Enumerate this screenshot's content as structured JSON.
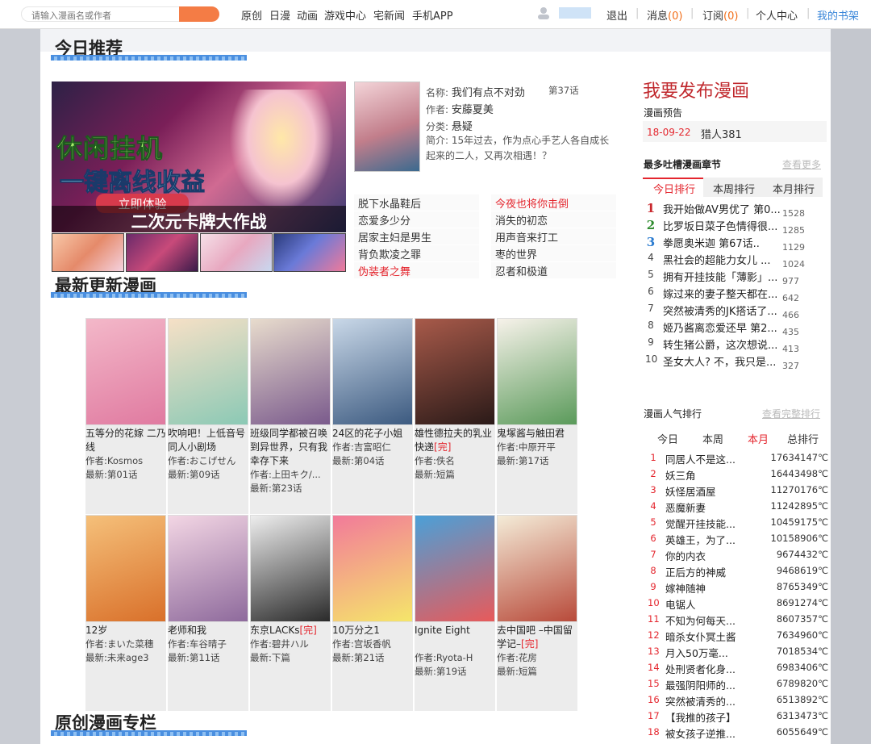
{
  "topbar": {
    "search_placeholder": "请输入漫画名或作者",
    "nav": [
      "原创",
      "日漫",
      "动画",
      "游戏中心",
      "宅新闻",
      "手机APP"
    ],
    "exit": "退出",
    "messages_label": "消息",
    "messages_count": "(0)",
    "subscribe_label": "订阅",
    "subscribe_count": "(0)",
    "personal": "个人中心",
    "mybook": "我的书架"
  },
  "today": {
    "title": "今日推荐",
    "banner": {
      "line1": "休闲挂机",
      "line2": "一键离线收益",
      "button": "立即体验",
      "caption": "二次元卡牌大作战"
    },
    "featured": {
      "name_label": "名称:",
      "name": "我们有点不对劲",
      "chapter": "第37话",
      "author_label": "作者:",
      "author": "安藤夏美",
      "category_label": "分类:",
      "category": "悬疑",
      "intro_label": "简介:",
      "intro": "15年过去，作为点心手艺人各自成长起来的二人，又再次相遇！？"
    },
    "links": [
      {
        "text": "脱下水晶鞋后",
        "red": false
      },
      {
        "text": "今夜也将你击倒",
        "red": true
      },
      {
        "text": "恋爱多少分",
        "red": false
      },
      {
        "text": "消失的初恋",
        "red": false
      },
      {
        "text": "居家主妇是男生",
        "red": false
      },
      {
        "text": "用声音来打工",
        "red": false
      },
      {
        "text": "背负欺凌之罪",
        "red": false
      },
      {
        "text": "枣的世界",
        "red": false
      },
      {
        "text": "伪装者之舞",
        "red": true
      },
      {
        "text": "忍者和极道",
        "red": false
      }
    ]
  },
  "latest": {
    "title": "最新更新漫画",
    "row1": [
      {
        "title": "五等分的花嫁 二乃线",
        "author": "作者:Kosmos",
        "latest": "最新:第01话",
        "color1": "#f3b8c9",
        "color2": "#e07aa0"
      },
      {
        "title": "吹响吧！上低音号 同人小剧场",
        "author": "作者:おこげせん",
        "latest": "最新:第09话",
        "color1": "#f6e0c6",
        "color2": "#8bc9b5"
      },
      {
        "title": "班级同学都被召唤到异世界，只有我幸存下来",
        "author": "作者:上田キク/...",
        "latest": "最新:第23话",
        "color1": "#e8dccd",
        "color2": "#7a5a8c"
      },
      {
        "title": "24区的花子小姐",
        "author": "作者:吉富昭仁",
        "latest": "最新:第04话",
        "color1": "#c9d8e8",
        "color2": "#3c5a80"
      },
      {
        "title": "雄性德拉夫的乳业快递",
        "author": "作者:佚名",
        "latest": "最新:短篇",
        "done": "[完]",
        "color1": "#a85a4a",
        "color2": "#2a1a18"
      },
      {
        "title": "鬼塚酱与触田君",
        "author": "作者:中原开平",
        "latest": "最新:第17话",
        "color1": "#f7f2ea",
        "color2": "#5a9a5a"
      }
    ],
    "row2": [
      {
        "title": "12岁",
        "author": "作者:まいた菜穗",
        "latest": "最新:未来age3",
        "color1": "#f5c07a",
        "color2": "#d9702a"
      },
      {
        "title": "老师和我",
        "author": "作者:车谷晴子",
        "latest": "最新:第11话",
        "color1": "#f3d6e4",
        "color2": "#8e6a9c"
      },
      {
        "title": "东京LACKs",
        "author": "作者:碧井ハル",
        "latest": "最新:下篇",
        "done": "[完]",
        "color1": "#eeeeee",
        "color2": "#2a2a2a"
      },
      {
        "title": "10万分之1",
        "author": "作者:宫坂香帆",
        "latest": "最新:第21话",
        "color1": "#f27a9a",
        "color2": "#f5e66a"
      },
      {
        "title": "Ignite Eight",
        "author": "作者:Ryota-H",
        "latest": "最新:第19话",
        "color1": "#4aa0d8",
        "color2": "#e85a5a"
      },
      {
        "title": "去中国吧 –中国留学记–",
        "author": "作者:花房",
        "latest": "最新:短篇",
        "done": "[完]",
        "color1": "#f4ecd8",
        "color2": "#b84a3a"
      }
    ]
  },
  "original": {
    "title": "原创漫画专栏"
  },
  "right": {
    "publish": "我要发布漫画",
    "preview_label": "漫画预告",
    "preview_date": "18-09-22",
    "preview_name": "猎人381",
    "chapter_title": "最多吐槽漫画章节",
    "chapter_more": "查看更多",
    "chapter_tabs": [
      "今日排行",
      "本周排行",
      "本月排行"
    ],
    "chapters": [
      {
        "n": "1",
        "t": "我开始做AV男优了 第0...",
        "c": "1528"
      },
      {
        "n": "2",
        "t": "比罗坂日菜子色情得很...",
        "c": "1285"
      },
      {
        "n": "3",
        "t": "拳愿奥米迦 第67话..",
        "c": "1129"
      },
      {
        "n": "4",
        "t": "黑社会的超能力女儿 ...",
        "c": "1024"
      },
      {
        "n": "5",
        "t": "拥有开挂技能「薄影」...",
        "c": "977"
      },
      {
        "n": "6",
        "t": "嫁过来的妻子整天都在...",
        "c": "642"
      },
      {
        "n": "7",
        "t": "突然被清秀的JK搭话了...",
        "c": "466"
      },
      {
        "n": "8",
        "t": "姬乃酱离恋爱还早 第2...",
        "c": "435"
      },
      {
        "n": "9",
        "t": "转生猪公爵，这次想说...",
        "c": "413"
      },
      {
        "n": "10",
        "t": "圣女大人? 不，我只是...",
        "c": "327"
      }
    ],
    "pop_title": "漫画人气排行",
    "pop_more": "查看完整排行",
    "pop_tabs": [
      "今日",
      "本周",
      "本月",
      "总排行"
    ],
    "pop": [
      {
        "n": "1",
        "t": "同居人不是这...",
        "c": "17634147℃"
      },
      {
        "n": "2",
        "t": "妖三角",
        "c": "16443498℃"
      },
      {
        "n": "3",
        "t": "妖怪居酒屋",
        "c": "11270176℃"
      },
      {
        "n": "4",
        "t": "恶魔新妻",
        "c": "11242895℃"
      },
      {
        "n": "5",
        "t": "觉醒开挂技能...",
        "c": "10459175℃"
      },
      {
        "n": "6",
        "t": "英雄王，为了...",
        "c": "10158906℃"
      },
      {
        "n": "7",
        "t": "你的内衣",
        "c": "9674432℃"
      },
      {
        "n": "8",
        "t": "正后方的神威",
        "c": "9468619℃"
      },
      {
        "n": "9",
        "t": "嫁神随神",
        "c": "8765349℃"
      },
      {
        "n": "10",
        "t": "电锯人",
        "c": "8691274℃"
      },
      {
        "n": "11",
        "t": "不知为何每天...",
        "c": "8607357℃"
      },
      {
        "n": "12",
        "t": "暗杀女仆冥土酱",
        "c": "7634960℃"
      },
      {
        "n": "13",
        "t": "月入50万毫...",
        "c": "7018534℃"
      },
      {
        "n": "14",
        "t": "处刑贤者化身...",
        "c": "6983406℃"
      },
      {
        "n": "15",
        "t": "最强阴阳师的...",
        "c": "6789820℃"
      },
      {
        "n": "16",
        "t": "突然被清秀的...",
        "c": "6513892℃"
      },
      {
        "n": "17",
        "t": "【我推的孩子】",
        "c": "6313473℃"
      },
      {
        "n": "18",
        "t": "被女孩子逆推...",
        "c": "6055649℃"
      }
    ]
  }
}
